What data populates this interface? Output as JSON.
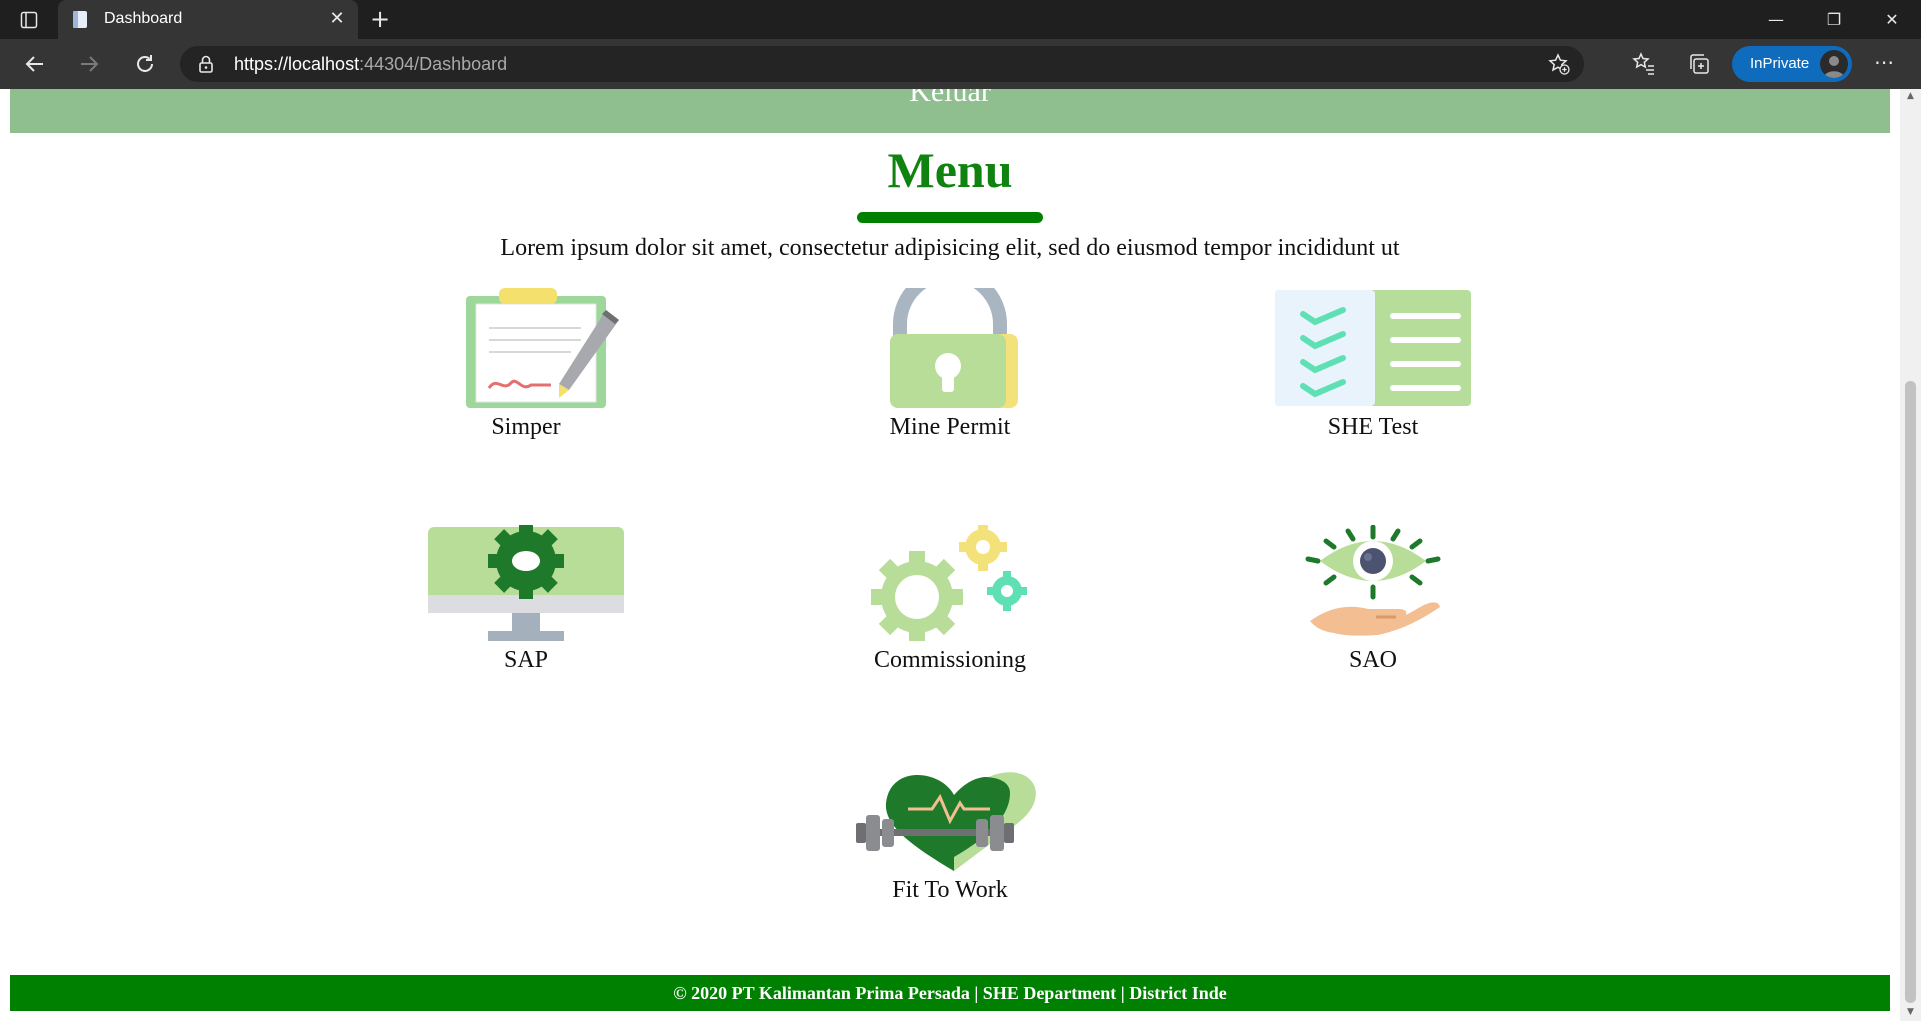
{
  "browser": {
    "tab_title": "Dashboard",
    "url_host": "https://localhost",
    "url_rest": ":44304/Dashboard",
    "inprivate_label": "InPrivate"
  },
  "page": {
    "hero_text": "Keluar",
    "menu_title": "Menu",
    "menu_description": "Lorem ipsum dolor sit amet, consectetur adipisicing elit, sed do eiusmod tempor incididunt ut",
    "menu_items": [
      {
        "label": "Simper",
        "icon": "clipboard-pen-icon"
      },
      {
        "label": "Mine Permit",
        "icon": "padlock-icon"
      },
      {
        "label": "SHE Test",
        "icon": "checklist-icon"
      },
      {
        "label": "SAP",
        "icon": "monitor-gear-icon"
      },
      {
        "label": "Commissioning",
        "icon": "gears-icon"
      },
      {
        "label": "SAO",
        "icon": "eye-hand-icon"
      },
      {
        "label": "Fit To Work",
        "icon": "heart-dumbbell-icon"
      }
    ],
    "footer_text": "© 2020 PT Kalimantan Prima Persada | SHE Department | District Inde"
  },
  "colors": {
    "brand_green": "#008000",
    "hero_green": "#8fbe8f",
    "title_green": "#108210"
  }
}
